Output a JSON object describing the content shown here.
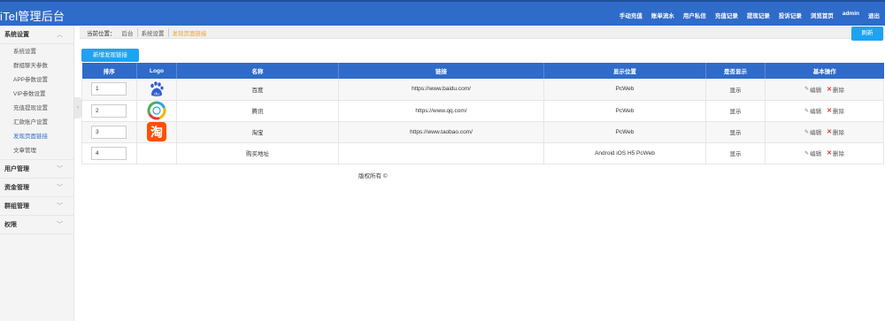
{
  "brand": "iTel管理后台",
  "topnav": [
    "手动充值",
    "账单流水",
    "用户私信",
    "充值记录",
    "提现记录",
    "投诉记录",
    "浏览首页",
    "admin",
    "退出"
  ],
  "sidebar": {
    "groups": [
      {
        "label": "系统设置",
        "expanded": true,
        "items": [
          "系统设置",
          "群组聊天参数",
          "APP参数设置",
          "VIP参数设置",
          "充值提现设置",
          "汇款账户设置",
          "发现页面链接",
          "文章管理"
        ],
        "active_index": 6
      },
      {
        "label": "用户管理",
        "expanded": false
      },
      {
        "label": "资金管理",
        "expanded": false
      },
      {
        "label": "群组管理",
        "expanded": false
      },
      {
        "label": "权限",
        "expanded": false
      }
    ]
  },
  "breadcrumb": {
    "prefix": "当前位置：",
    "items": [
      "后台",
      "系统设置",
      "发现页面链接"
    ]
  },
  "refresh_label": "刷新",
  "add_button_label": "新增发现链接",
  "table": {
    "headers": [
      "排序",
      "Logo",
      "名称",
      "链接",
      "显示位置",
      "是否显示",
      "基本操作"
    ],
    "rows": [
      {
        "sort": "1",
        "logo": "baidu-logo",
        "name": "百度",
        "url": "https://www.baidu.com/",
        "position": "PcWeb",
        "visible": "显示",
        "edit": "编辑",
        "delete": "删除"
      },
      {
        "sort": "2",
        "logo": "qq-logo",
        "name": "腾讯",
        "url": "https://www.qq.com/",
        "position": "PcWeb",
        "visible": "显示",
        "edit": "编辑",
        "delete": "删除"
      },
      {
        "sort": "3",
        "logo": "taobao-logo",
        "name": "淘宝",
        "url": "https://www.taobao.com/",
        "position": "PcWeb",
        "visible": "显示",
        "edit": "编辑",
        "delete": "删除"
      },
      {
        "sort": "4",
        "logo": "",
        "name": "购买地址",
        "url": "",
        "position": "Android iOS H5 PcWeb",
        "visible": "显示",
        "edit": "编辑",
        "delete": "删除"
      }
    ]
  },
  "footer": "版权所有 ©",
  "colors": {
    "primary": "#2f6bc9",
    "button": "#1da3f2",
    "active_crumb": "#f0a030",
    "delete_icon": "#dd3333"
  }
}
